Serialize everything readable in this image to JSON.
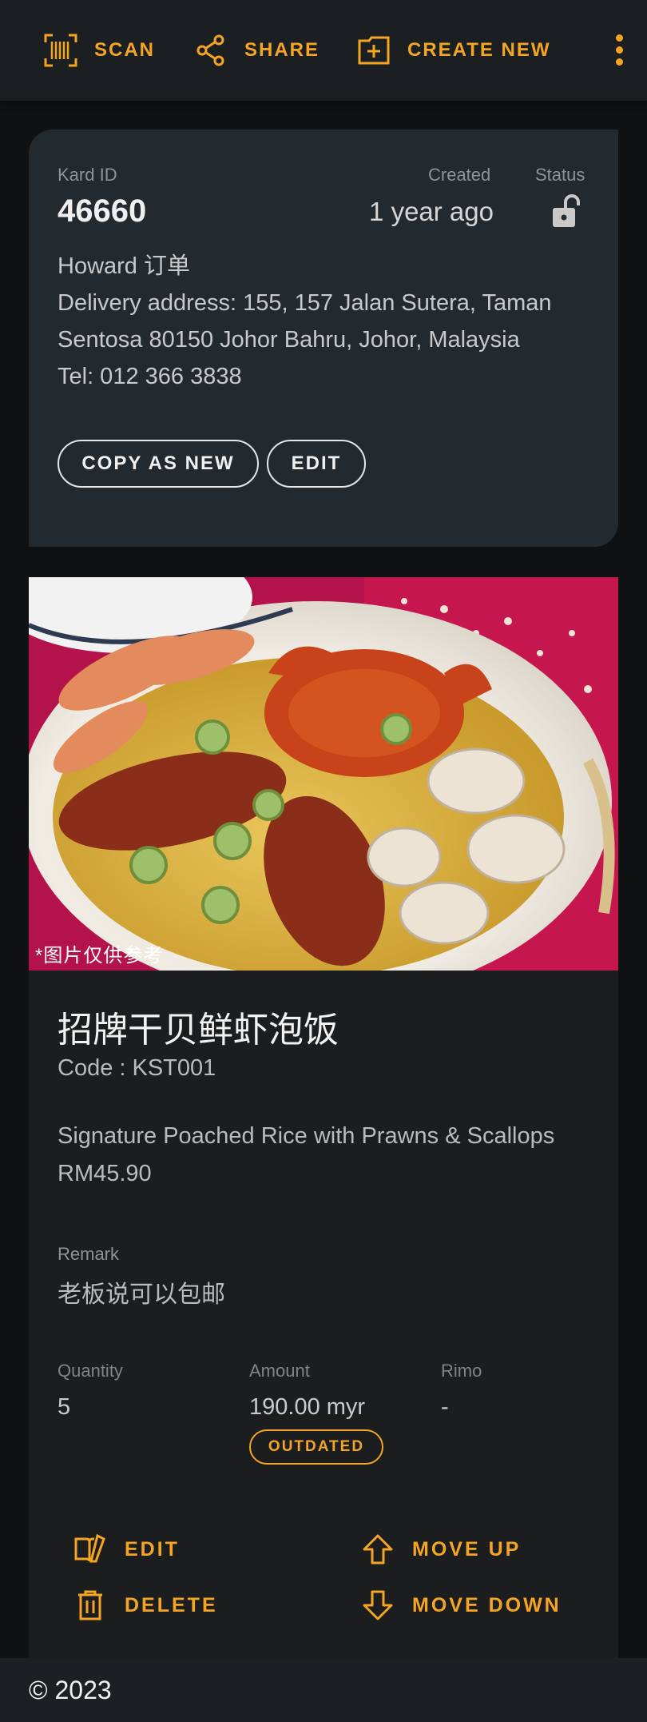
{
  "topbar": {
    "scan_label": "SCAN",
    "share_label": "SHARE",
    "create_label": "CREATE NEW",
    "accent_color": "#f5a524"
  },
  "kard": {
    "id_label": "Kard ID",
    "id_value": "46660",
    "created_label": "Created",
    "created_value": "1 year ago",
    "status_label": "Status",
    "status_icon": "unlock-icon",
    "name_line": "Howard 订单",
    "address_line": "Delivery address: 155, 157 Jalan Sutera, Taman Sentosa 80150 Johor Bahru, Johor, Malaysia",
    "tel_line": "Tel: 012 366 3838",
    "copy_label": "COPY AS NEW",
    "edit_label": "EDIT"
  },
  "item": {
    "image_caption": "*图片仅供参考",
    "name_cn": "招牌干贝鲜虾泡饭",
    "code": "Code : KST001",
    "name_en": "Signature Poached Rice with Prawns & Scallops",
    "price": "RM45.90",
    "remark_label": "Remark",
    "remark_value": "老板说可以包邮",
    "quantity_label": "Quantity",
    "quantity_value": "5",
    "amount_label": "Amount",
    "amount_value": "190.00 myr",
    "rimo_label": "Rimo",
    "rimo_value": "-",
    "badge": "OUTDATED",
    "actions": {
      "edit": "EDIT",
      "move_up": "MOVE UP",
      "delete": "DELETE",
      "move_down": "MOVE DOWN"
    }
  },
  "footer": {
    "copyright": "© 2023"
  }
}
